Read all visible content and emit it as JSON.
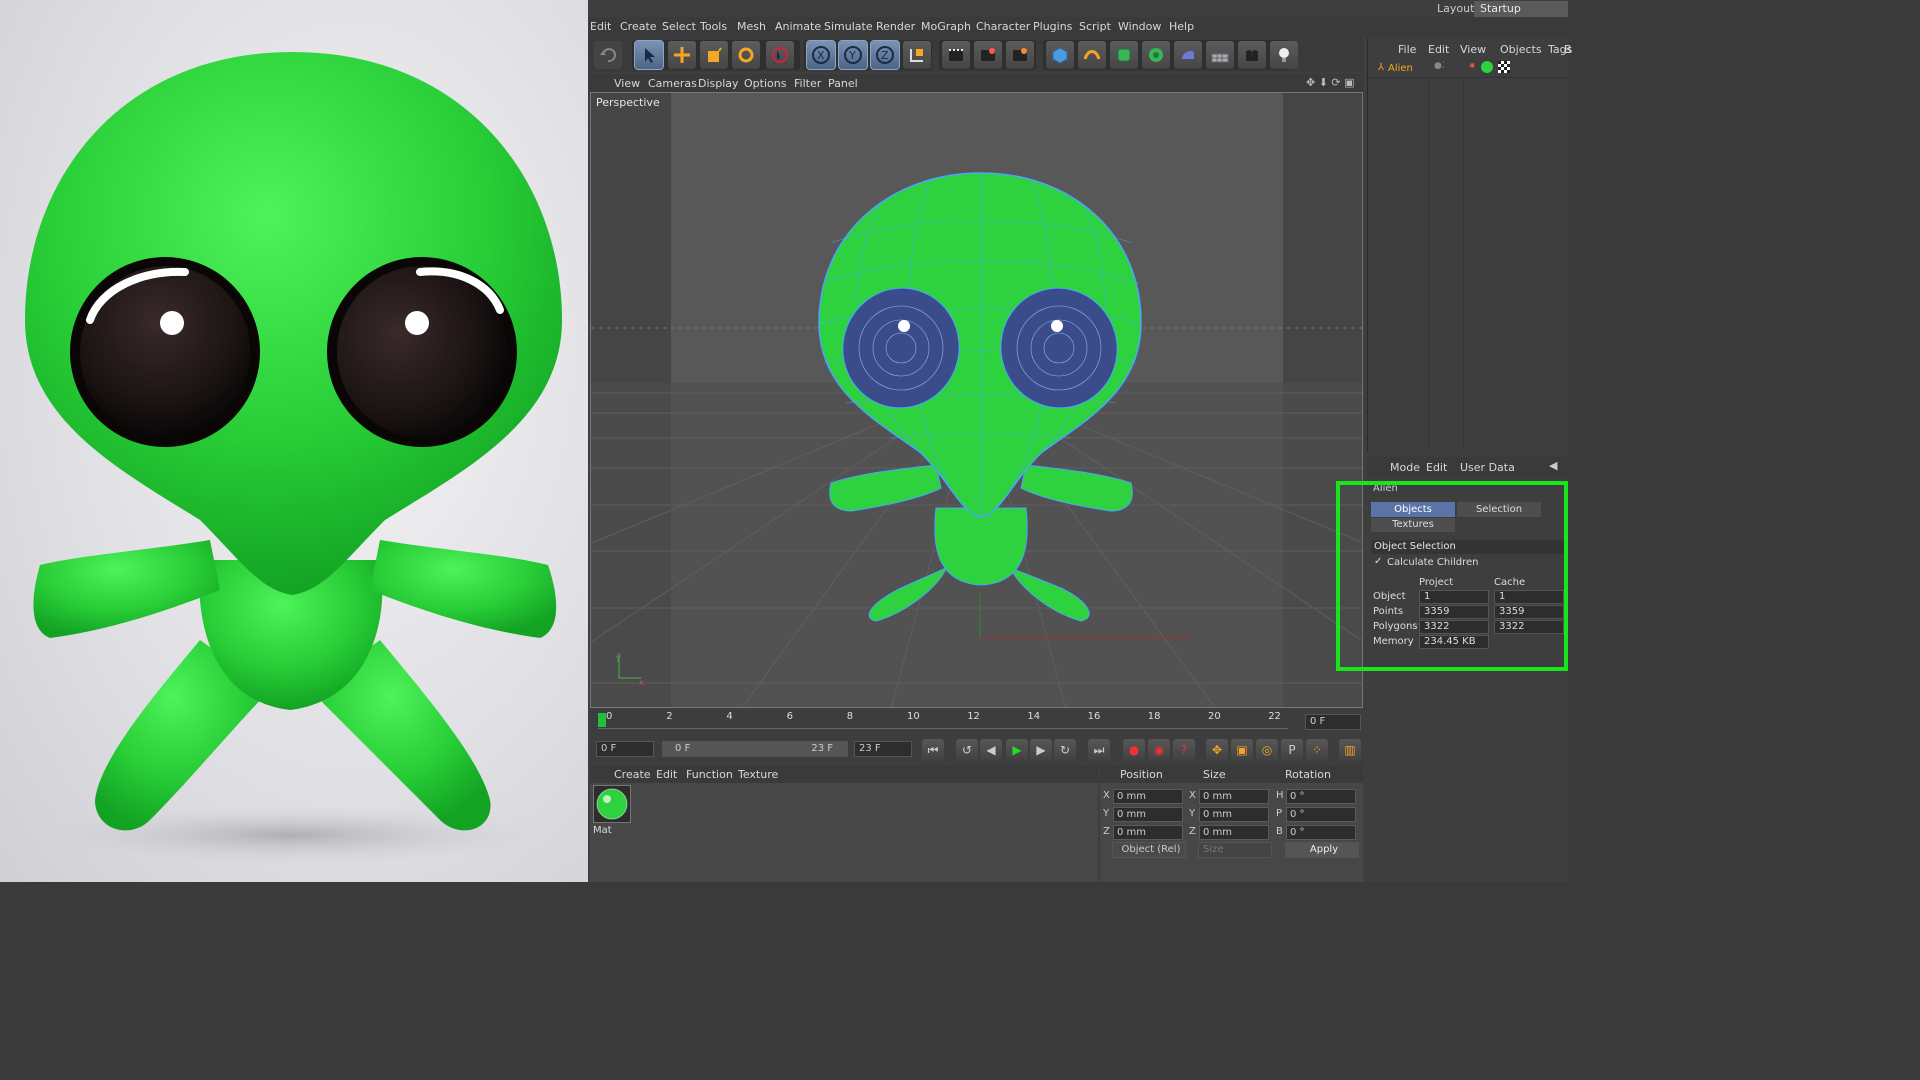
{
  "menu": [
    "Edit",
    "Create",
    "Select",
    "Tools",
    "Mesh",
    "Animate",
    "Simulate",
    "Render",
    "MoGraph",
    "Character",
    "Plugins",
    "Script",
    "Window",
    "Help"
  ],
  "layout": {
    "label": "Layout:",
    "value": "Startup"
  },
  "toolbar_icons": [
    "undo-icon",
    "move-select-icon",
    "move-icon",
    "scale-icon",
    "rotate-icon",
    "live-select-icon",
    "x-axis-icon",
    "y-axis-icon",
    "z-axis-icon",
    "coordinate-system-icon",
    "render-view-icon",
    "render-picture-viewer-icon",
    "render-settings-icon",
    "cube-icon",
    "spline-icon",
    "nurbs-icon",
    "array-icon",
    "deformer-icon",
    "floor-icon",
    "camera-icon",
    "light-icon"
  ],
  "viewport": {
    "menu": [
      "View",
      "Cameras",
      "Display",
      "Options",
      "Filter",
      "Panel"
    ],
    "label": "Perspective"
  },
  "timeline": {
    "ticks": [
      "0",
      "2",
      "4",
      "6",
      "8",
      "10",
      "12",
      "14",
      "16",
      "18",
      "20",
      "22"
    ],
    "current_frame": "0 F"
  },
  "controls": {
    "start": "0 F",
    "range_start": "0 F",
    "range_end": "23 F",
    "end": "23 F"
  },
  "material_manager": {
    "menu": [
      "Create",
      "Edit",
      "Function",
      "Texture"
    ],
    "material_name": "Mat"
  },
  "coordinates": {
    "headers": [
      "Position",
      "Size",
      "Rotation"
    ],
    "rows": [
      {
        "pos_axis": "X",
        "pos": "0 mm",
        "size_axis": "X",
        "size": "0 mm",
        "rot_axis": "H",
        "rot": "0 °"
      },
      {
        "pos_axis": "Y",
        "pos": "0 mm",
        "size_axis": "Y",
        "size": "0 mm",
        "rot_axis": "P",
        "rot": "0 °"
      },
      {
        "pos_axis": "Z",
        "pos": "0 mm",
        "size_axis": "Z",
        "size": "0 mm",
        "rot_axis": "B",
        "rot": "0 °"
      }
    ],
    "mode": "Object (Rel)",
    "size_mode": "Size",
    "apply": "Apply"
  },
  "object_manager": {
    "menu": [
      "File",
      "Edit",
      "View",
      "Objects",
      "Tags",
      "B"
    ],
    "object_name": "Alien"
  },
  "attributes": {
    "menu": [
      "Mode",
      "Edit",
      "User Data"
    ],
    "title": "Alien",
    "tabs": [
      "Objects Selection",
      "Selection",
      "Textures"
    ],
    "section": "Object Selection",
    "calculate_children": "Calculate Children",
    "col_project": "Project",
    "col_cache": "Cache",
    "rows": [
      {
        "label": "Object",
        "project": "1",
        "cache": "1"
      },
      {
        "label": "Points",
        "project": "3359",
        "cache": "3359"
      },
      {
        "label": "Polygons",
        "project": "3322",
        "cache": "3322"
      },
      {
        "label": "Memory",
        "project": "234.45 KB",
        "cache": ""
      }
    ]
  },
  "colors": {
    "highlight": "#19e51b",
    "alien_green": "#2ed13e",
    "wire": "#4aa6ff"
  }
}
